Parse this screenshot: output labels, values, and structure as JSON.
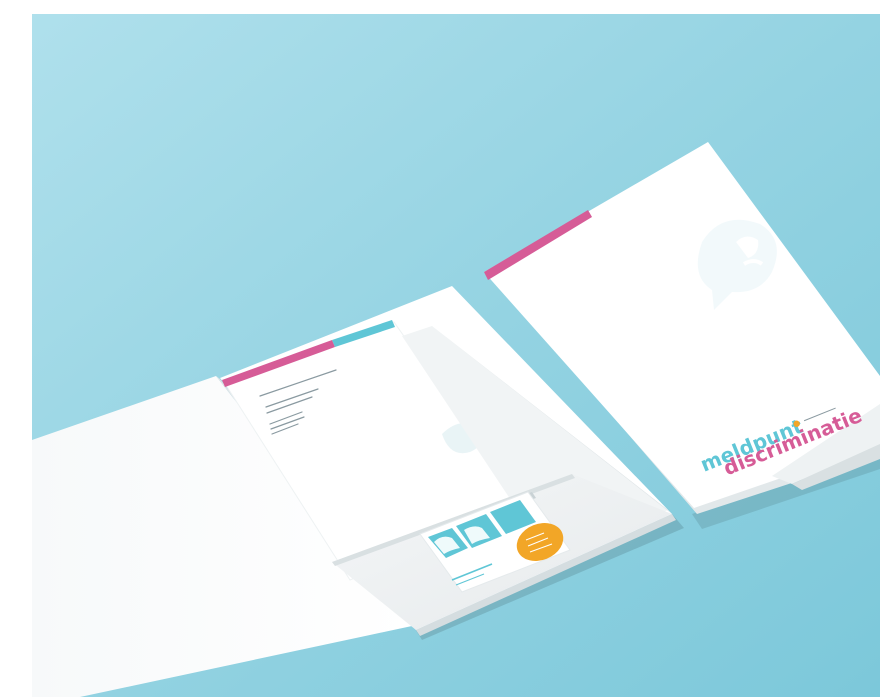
{
  "scene": {
    "background_color": "#8fd1e1",
    "paper_color": "#ffffff",
    "accent_pink": "#d65c97",
    "accent_cyan": "#5fc6d6",
    "accent_yellow": "#f2a627",
    "accent_orange": "#f0a33a"
  },
  "logo": {
    "line1": "meldpunt",
    "line2": "discriminatie",
    "tagline": "",
    "icon_name": "speech-bubble-logo-icon"
  },
  "business_card": {
    "name_line": "",
    "info_line": ""
  },
  "letter": {
    "text_lines_shown_as_placeholders": true
  }
}
